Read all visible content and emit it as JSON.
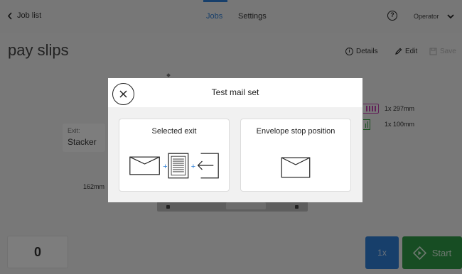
{
  "topbar": {
    "back_label": "Job list",
    "tabs": [
      {
        "label": "Jobs",
        "active": true
      },
      {
        "label": "Settings",
        "active": false
      }
    ],
    "help_glyph": "?",
    "operator_label": "Operator"
  },
  "page": {
    "title": "pay slips",
    "actions": {
      "details": "Details",
      "edit": "Edit",
      "save": "Save"
    }
  },
  "background": {
    "exit_caption": "Exit:",
    "exit_value": "Stacker",
    "dim_left": "162mm",
    "dim_insert_1": "1x 297mm",
    "dim_insert_2": "1x 100mm",
    "colors": {
      "insert_1": "#c43fb0",
      "insert_2": "#3aa646"
    }
  },
  "bottom": {
    "counter": "0",
    "multiplier": "1x",
    "start_label": "Start"
  },
  "modal": {
    "title": "Test mail set",
    "options": [
      {
        "label": "Selected exit",
        "icon": "envelope-plus-document-plus-exit-icon"
      },
      {
        "label": "Envelope stop position",
        "icon": "envelope-icon"
      }
    ]
  },
  "colors": {
    "accent": "#2f7fd6",
    "start": "#2f9a46",
    "overlay": "rgba(0,0,0,0.5)"
  }
}
